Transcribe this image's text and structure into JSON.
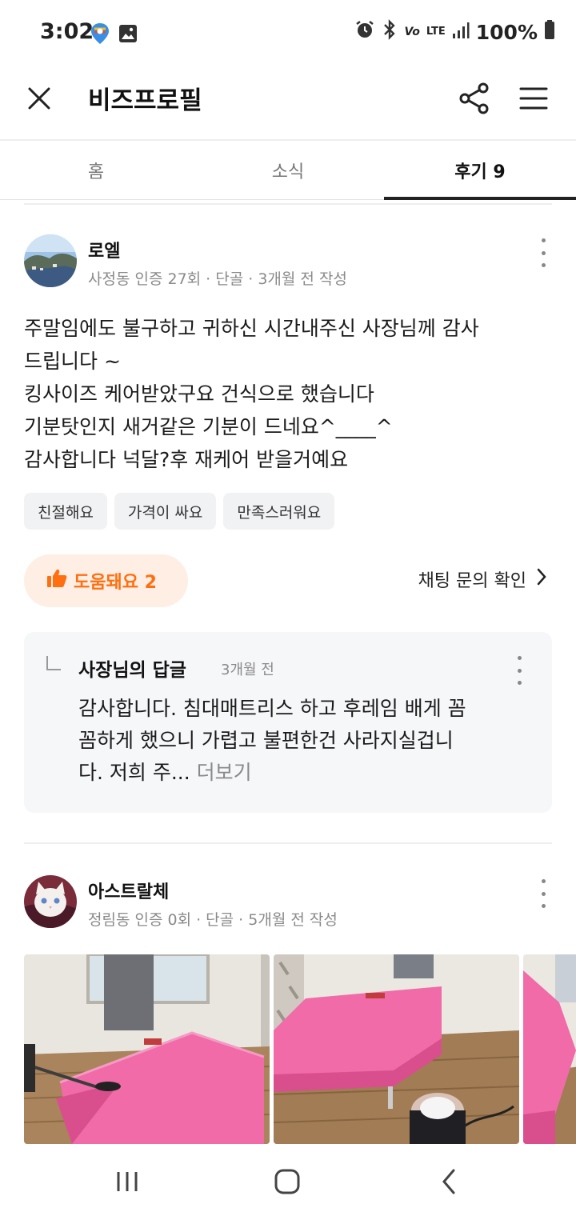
{
  "status_bar": {
    "time": "3:02",
    "battery": "100%",
    "signal_label": "LTE"
  },
  "app_bar": {
    "title": "비즈프로필",
    "close_icon": "close-icon",
    "share_icon": "share-icon",
    "menu_icon": "hamburger-menu-icon"
  },
  "tabs": [
    {
      "label": "홈",
      "active": false
    },
    {
      "label": "소식",
      "active": false
    },
    {
      "label": "후기 9",
      "active": true
    }
  ],
  "reviews": [
    {
      "user": "로엘",
      "meta": "사정동 인증 27회 · 단골 · 3개월 전 작성",
      "text_lines": [
        "주말임에도 불구하고 귀하신 시간내주신 사장님께 감사",
        "드립니다 ~",
        "킹사이즈 케어받았구요 건식으로 했습니다",
        "기분탓인지 새거같은 기분이 드네요^____^",
        "감사합니다 넉달?후 재케어 받을거예요"
      ],
      "tags": [
        "친절해요",
        "가격이 싸요",
        "만족스러워요"
      ],
      "helpful_label": "도움돼요 2",
      "chat_link": "채팅 문의 확인",
      "reply": {
        "title": "사장님의 답글",
        "time": "3개월 전",
        "text_lines": [
          "감사합니다. 침대매트리스 하고 후레임 배게 꼼",
          "꼼하게 했으니 가렵고 불편한건 사라지실겁니",
          "다. 저희 주..."
        ],
        "more_label": "더보기"
      }
    },
    {
      "user": "아스트랄체",
      "meta": "정림동 인증 0회 · 단골 · 5개월 전 작성"
    }
  ],
  "colors": {
    "accent": "#ff6f0f",
    "accent_bg": "#ffeee4",
    "tag_bg": "#f1f2f4",
    "reply_bg": "#f6f7f9",
    "mattress_pink": "#f06ba8"
  }
}
